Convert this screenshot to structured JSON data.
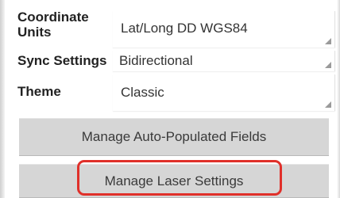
{
  "settings": {
    "coordinate_units": {
      "label": "Coordinate Units",
      "value": "Lat/Long DD WGS84"
    },
    "sync_settings": {
      "label": "Sync Settings",
      "value": "Bidirectional"
    },
    "theme": {
      "label": "Theme",
      "value": "Classic"
    }
  },
  "buttons": {
    "manage_auto_populated": "Manage Auto-Populated Fields",
    "manage_laser": "Manage Laser Settings"
  },
  "colors": {
    "highlight": "#e0302a",
    "button_bg": "#d6d6d6"
  }
}
